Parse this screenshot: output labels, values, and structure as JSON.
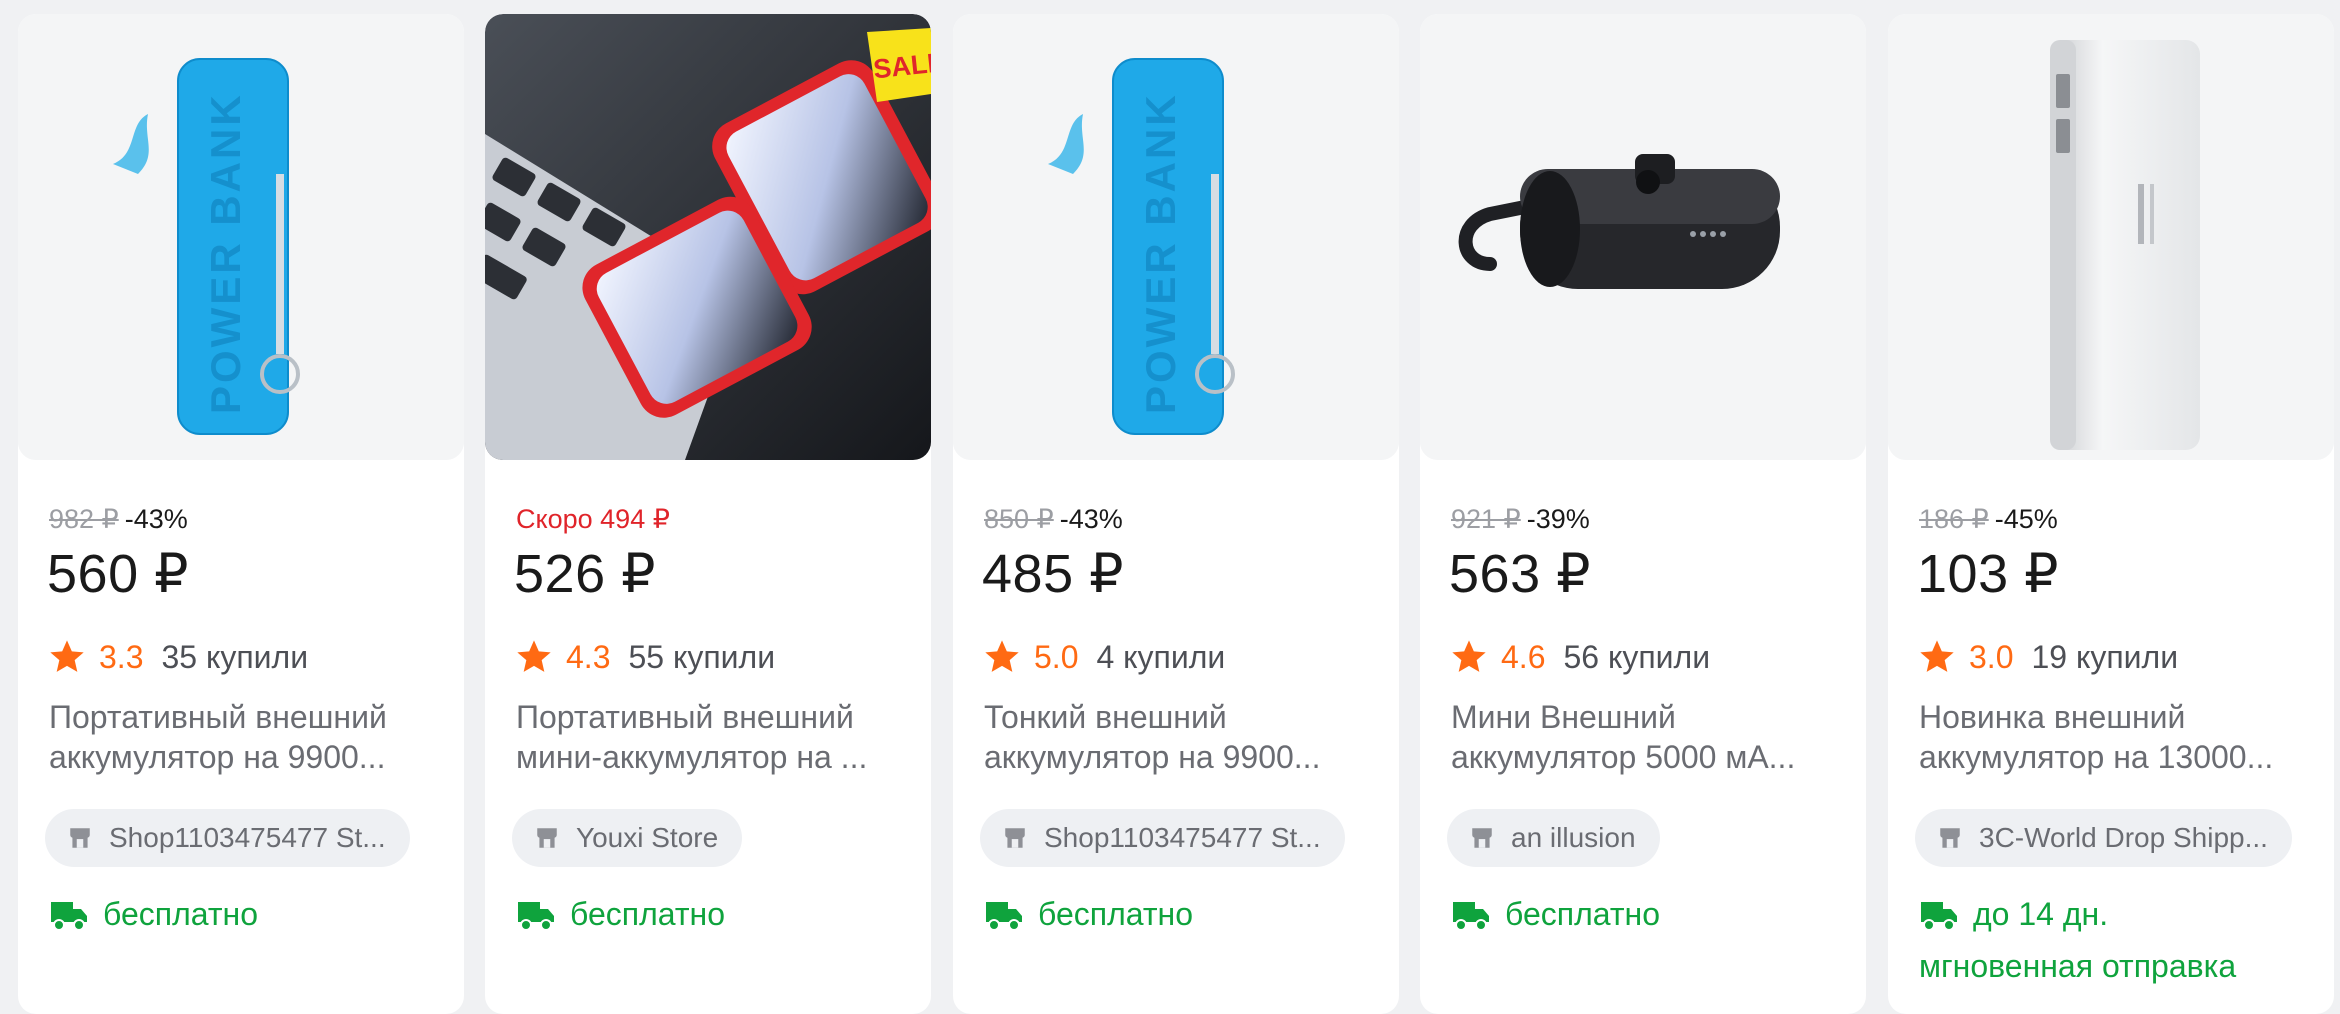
{
  "products": [
    {
      "old_price": "982 ₽",
      "discount": "-43%",
      "price": "560 ₽",
      "rating": "3.3",
      "bought": "35 купили",
      "title_line1": "Портативный внешний",
      "title_line2": "аккумулятор на 9900...",
      "store": "Shop1103475477 St...",
      "delivery": "бесплатно",
      "image_text": "POWER BANK"
    },
    {
      "soon_price": "Скоро 494 ₽",
      "price": "526 ₽",
      "rating": "4.3",
      "bought": "55 купили",
      "title_line1": "Портативный внешний",
      "title_line2": "мини-аккумулятор на ...",
      "store": "Youxi Store",
      "delivery": "бесплатно",
      "badge": "SALE"
    },
    {
      "old_price": "850 ₽",
      "discount": "-43%",
      "price": "485 ₽",
      "rating": "5.0",
      "bought": "4 купили",
      "title_line1": "Тонкий внешний",
      "title_line2": "аккумулятор на 9900...",
      "store": "Shop1103475477 St...",
      "delivery": "бесплатно",
      "image_text": "POWER BANK"
    },
    {
      "old_price": "921 ₽",
      "discount": "-39%",
      "price": "563 ₽",
      "rating": "4.6",
      "bought": "56 купили",
      "title_line1": "Мини Внешний",
      "title_line2": "аккумулятор 5000 мА...",
      "store": "an illusion",
      "delivery": "бесплатно"
    },
    {
      "old_price": "186 ₽",
      "discount": "-45%",
      "price": "103 ₽",
      "rating": "3.0",
      "bought": "19 купили",
      "title_line1": "Новинка внешний",
      "title_line2": "аккумулятор на 13000...",
      "store": "3C-World Drop Shipp...",
      "delivery": "до 14 дн.",
      "delivery_extra": "мгновенная отправка"
    }
  ],
  "colors": {
    "rating_orange": "#ff6a13",
    "delivery_green": "#0fa33d",
    "soon_red": "#e0242a",
    "old_price_grey": "#9c9ea3"
  },
  "icons": [
    "star-icon",
    "store-icon",
    "truck-icon"
  ]
}
